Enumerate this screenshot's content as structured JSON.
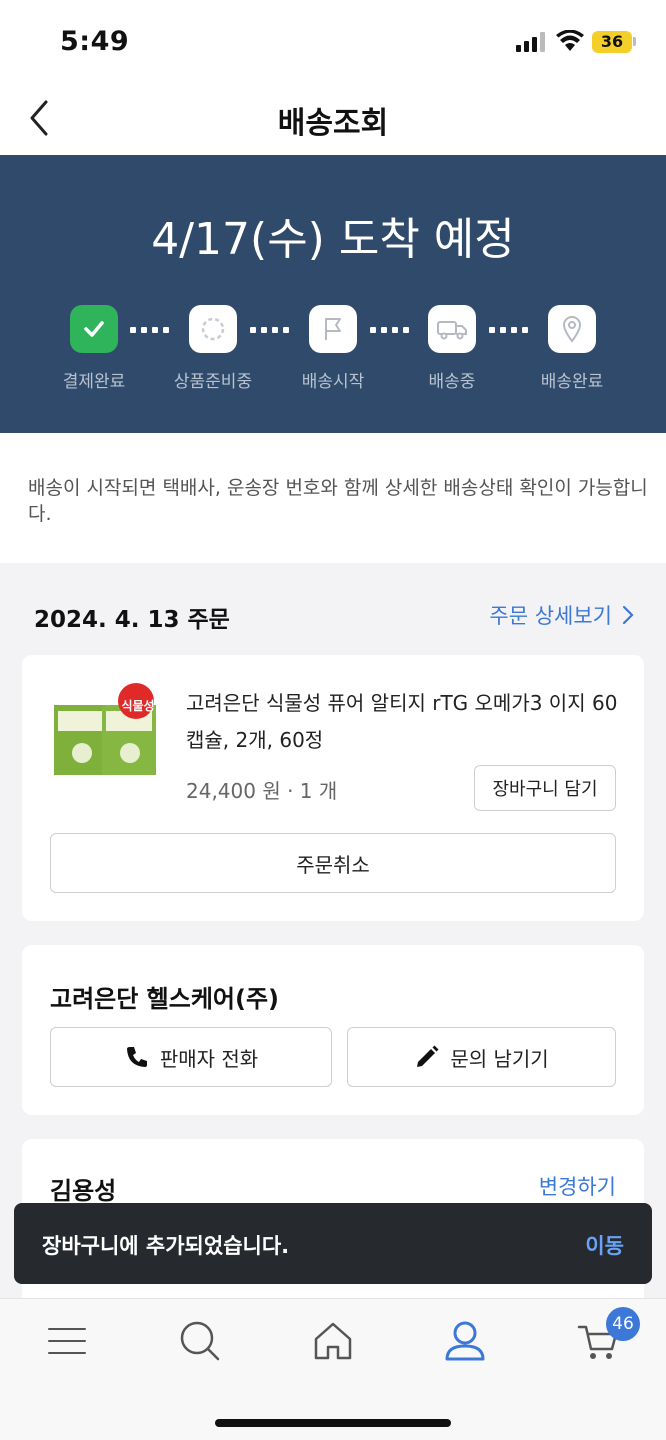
{
  "status_bar": {
    "time": "5:49",
    "battery": "36"
  },
  "header": {
    "title": "배송조회"
  },
  "banner": {
    "arrival": "4/17(수) 도착 예정",
    "steps": [
      {
        "label": "결제완료",
        "icon": "check-icon",
        "done": true
      },
      {
        "label": "상품준비중",
        "icon": "preparing-icon",
        "done": false
      },
      {
        "label": "배송시작",
        "icon": "flag-icon",
        "done": false
      },
      {
        "label": "배송중",
        "icon": "truck-icon",
        "done": false
      },
      {
        "label": "배송완료",
        "icon": "location-pin-icon",
        "done": false
      }
    ],
    "active_color": "#2fb35b"
  },
  "notice": {
    "text": "배송이 시작되면 택배사, 운송장 번호와 함께 상세한 배송상태 확인이 가능합니다."
  },
  "order": {
    "date": "2024. 4. 13 주문",
    "detail_link": "주문 상세보기",
    "product": {
      "badge": "식물성",
      "name": "고려은단 식물성 퓨어 알티지 rTG 오메가3 이지 60캡슐, 2개, 60정",
      "price_qty": "24,400 원 · 1 개",
      "cart_button": "장바구니 담기",
      "cancel_button": "주문취소"
    }
  },
  "seller": {
    "name": "고려은단 헬스케어(주)",
    "call_button": "판매자 전화",
    "inquiry_button": "문의 남기기"
  },
  "address": {
    "receiver": "김용성",
    "change_link": "변경하기"
  },
  "toast": {
    "message": "장바구니에 추가되었습니다.",
    "action": "이동"
  },
  "bottom_nav": {
    "items": [
      "menu-icon",
      "search-icon",
      "home-icon",
      "user-icon",
      "cart-icon"
    ],
    "active": "user-icon",
    "cart_count": "46",
    "accent": "#3b78d8"
  }
}
